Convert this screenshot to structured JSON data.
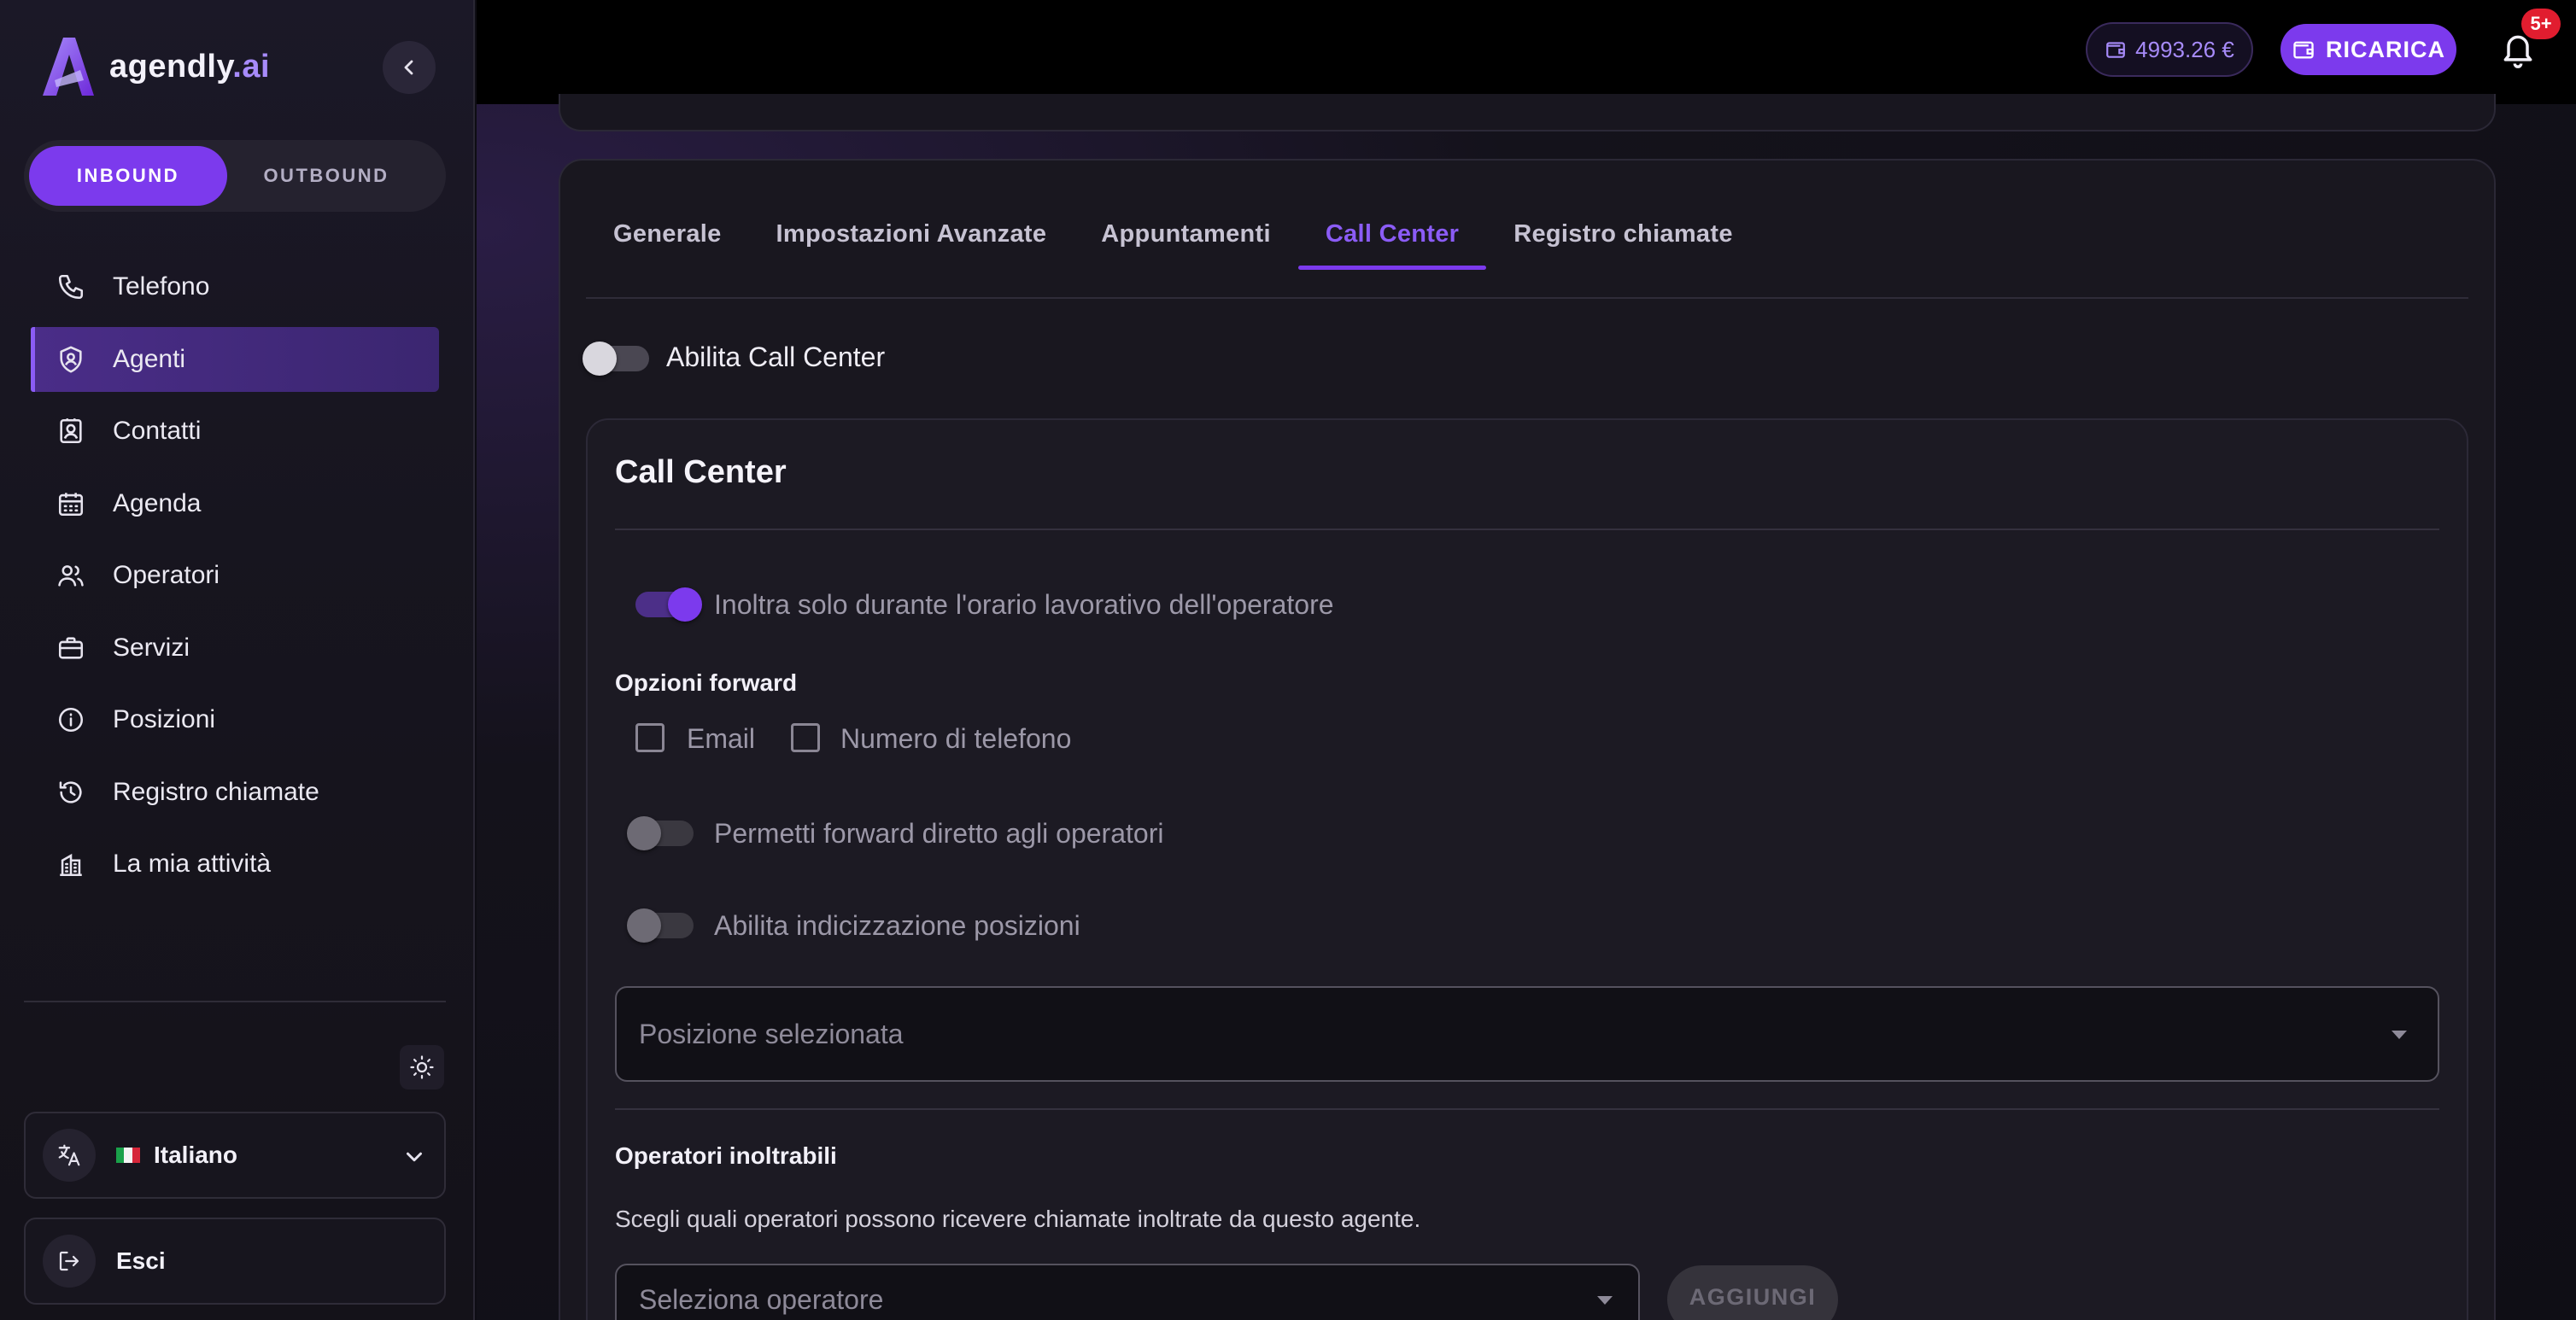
{
  "brand": {
    "name": "agendly",
    "suffix": ".ai"
  },
  "mode_toggle": {
    "inbound": "INBOUND",
    "outbound": "OUTBOUND",
    "selected": "INBOUND"
  },
  "sidebar": {
    "items": [
      {
        "label": "Telefono",
        "icon": "phone-icon"
      },
      {
        "label": "Agenti",
        "icon": "shield-user-icon",
        "active": true
      },
      {
        "label": "Contatti",
        "icon": "contact-card-icon"
      },
      {
        "label": "Agenda",
        "icon": "calendar-icon"
      },
      {
        "label": "Operatori",
        "icon": "users-icon"
      },
      {
        "label": "Servizi",
        "icon": "briefcase-icon"
      },
      {
        "label": "Posizioni",
        "icon": "info-icon"
      },
      {
        "label": "Registro chiamate",
        "icon": "history-icon"
      },
      {
        "label": "La mia attività",
        "icon": "building-icon"
      }
    ],
    "language": "Italiano",
    "logout": "Esci"
  },
  "topbar": {
    "balance": "4993.26 €",
    "recharge": "RICARICA",
    "notifications_badge": "5+"
  },
  "tabs": [
    {
      "label": "Generale"
    },
    {
      "label": "Impostazioni Avanzate"
    },
    {
      "label": "Appuntamenti"
    },
    {
      "label": "Call Center",
      "active": true
    },
    {
      "label": "Registro chiamate"
    }
  ],
  "call_center": {
    "enable_label": "Abilita Call Center",
    "enabled": false,
    "card_title": "Call Center",
    "working_hours_label": "Inoltra solo durante l'orario lavorativo dell'operatore",
    "working_hours_on": true,
    "forward_options_title": "Opzioni forward",
    "forward_email": "Email",
    "forward_phone": "Numero di telefono",
    "direct_forward_label": "Permetti forward diretto agli operatori",
    "position_indexing_label": "Abilita indicizzazione posizioni",
    "position_placeholder": "Posizione selezionata",
    "operators_title": "Operatori inoltrabili",
    "operators_desc": "Scegli quali operatori possono ricevere chiamate inoltrate da questo agente.",
    "operator_placeholder": "Seleziona operatore",
    "add_button": "AGGIUNGI"
  },
  "colors": {
    "accent": "#7c3aed",
    "accent_light": "#8b5cf6",
    "badge": "#e11d2f"
  }
}
